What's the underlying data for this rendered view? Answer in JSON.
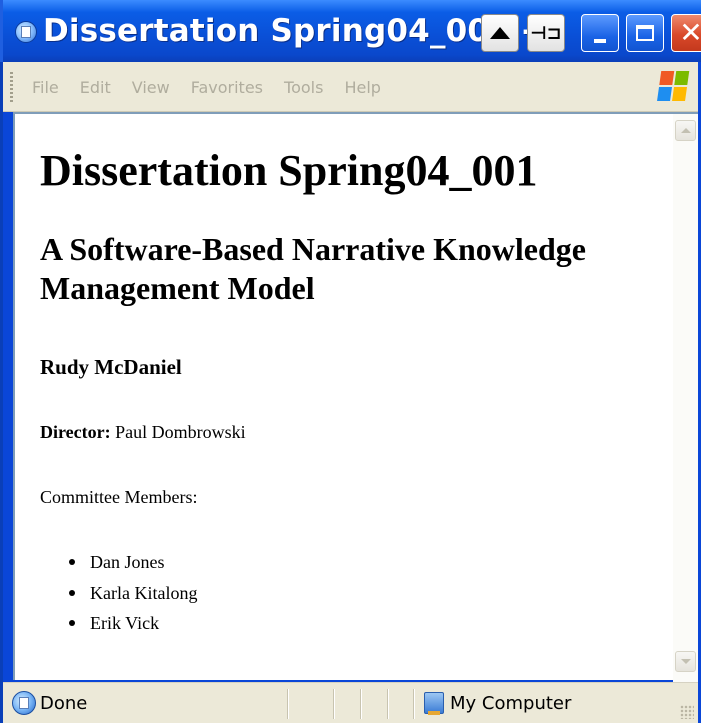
{
  "window": {
    "title": "Dissertation Spring04_001 -",
    "title_icon": "ie-page-icon",
    "buttons": [
      "up-arrow",
      "pin",
      "minimize",
      "maximize",
      "close"
    ],
    "pin_glyph": "⊣⊐",
    "close_glyph": "✕"
  },
  "menubar": {
    "items": [
      {
        "label": "File"
      },
      {
        "label": "Edit"
      },
      {
        "label": "View"
      },
      {
        "label": "Favorites"
      },
      {
        "label": "Tools"
      },
      {
        "label": "Help"
      }
    ],
    "logo": "windows-flag-logo"
  },
  "document": {
    "title": "Dissertation Spring04_001",
    "subtitle": "A Software-Based Narrative Knowledge Management Model",
    "author": "Rudy McDaniel",
    "director_label": "Director:",
    "director_name": "Paul Dombrowski",
    "committee_label": "Committee Members:",
    "committee": [
      {
        "name": "Dan Jones"
      },
      {
        "name": "Karla Kitalong"
      },
      {
        "name": "Erik Vick"
      }
    ]
  },
  "statusbar": {
    "status": "Done",
    "zone": "My Computer"
  },
  "colors": {
    "titlebar": "#0a4fd6",
    "close": "#d9492a",
    "chrome": "#ece9d8",
    "menu_text_disabled": "#b0ad9e"
  }
}
